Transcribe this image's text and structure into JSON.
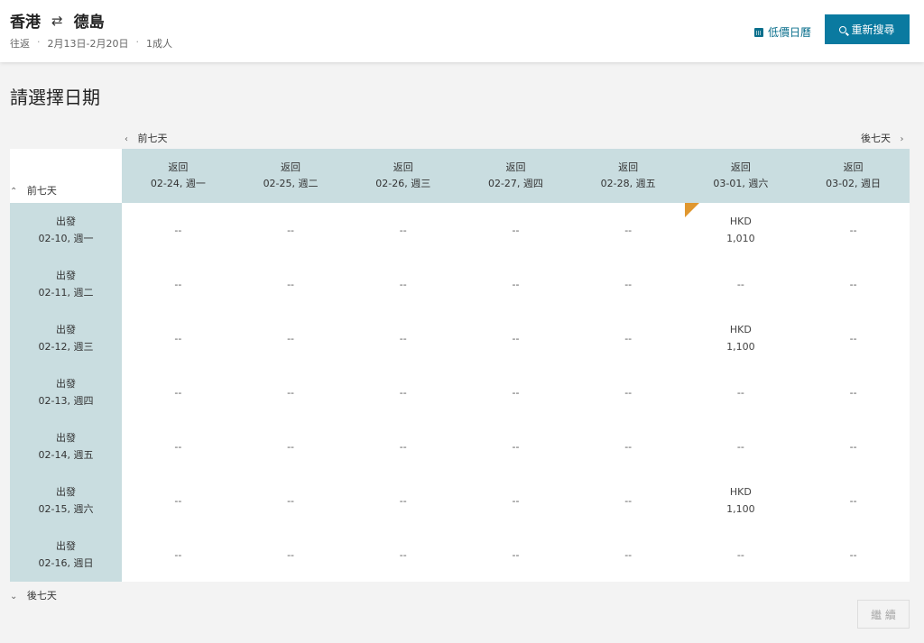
{
  "header": {
    "origin": "香港",
    "swap_glyph": "⇄",
    "destination": "德島",
    "trip_type": "往返",
    "dates": "2月13日-2月20日",
    "passengers": "1成人",
    "info_sep": "·",
    "low_price_calendar": "低價日曆",
    "search_again": "重新搜尋"
  },
  "page_title": "請選擇日期",
  "nav": {
    "prev_week": "前七天",
    "next_week": "後七天",
    "prev_chevron": "‹",
    "next_chevron": "›",
    "up_chevron": "⌃",
    "down_chevron": "⌄"
  },
  "grid": {
    "return_label": "返回",
    "depart_label": "出發",
    "return_dates": [
      "02-24, 週一",
      "02-25, 週二",
      "02-26, 週三",
      "02-27, 週四",
      "02-28, 週五",
      "03-01, 週六",
      "03-02, 週日"
    ],
    "depart_dates": [
      "02-10, 週一",
      "02-11, 週二",
      "02-12, 週三",
      "02-13, 週四",
      "02-14, 週五",
      "02-15, 週六",
      "02-16, 週日"
    ],
    "empty": "--",
    "currency": "HKD",
    "prices": [
      [
        null,
        null,
        null,
        null,
        null,
        "1,010",
        null
      ],
      [
        null,
        null,
        null,
        null,
        null,
        null,
        null
      ],
      [
        null,
        null,
        null,
        null,
        null,
        "1,100",
        null
      ],
      [
        null,
        null,
        null,
        null,
        null,
        null,
        null
      ],
      [
        null,
        null,
        null,
        null,
        null,
        null,
        null
      ],
      [
        null,
        null,
        null,
        null,
        null,
        "1,100",
        null
      ],
      [
        null,
        null,
        null,
        null,
        null,
        null,
        null
      ]
    ],
    "lowest_flag_cell": [
      0,
      5
    ]
  },
  "continue_label": "繼 續",
  "colors": {
    "accent": "#0a7aa0",
    "header_cell": "#c9dde0",
    "cheapest_flag": "#e0972f"
  }
}
